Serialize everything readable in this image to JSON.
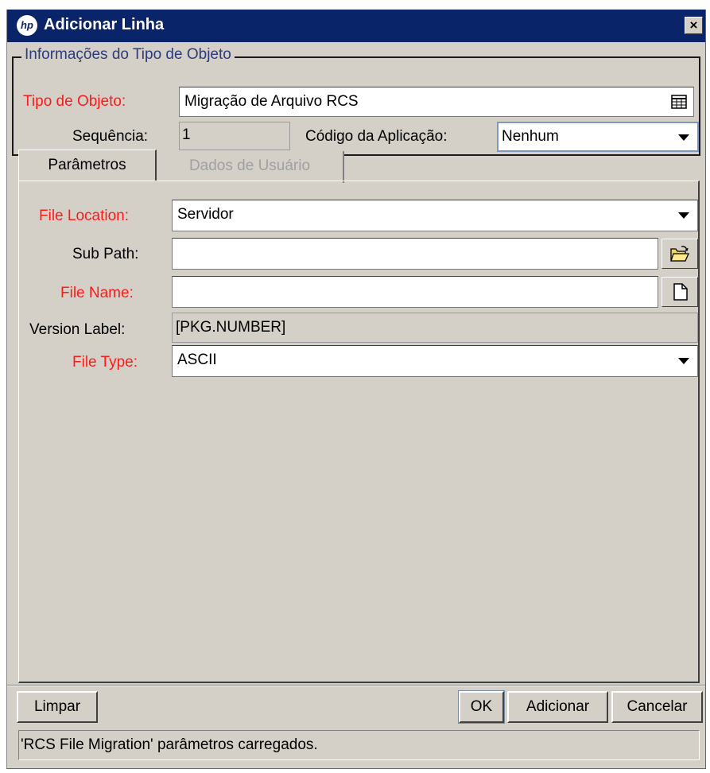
{
  "window": {
    "title": "Adicionar Linha",
    "logo_text": "hp",
    "close_label": "×"
  },
  "object_info": {
    "legend": "Informações do Tipo de Objeto",
    "object_type_label": "Tipo de Objeto:",
    "object_type_value": "Migração de Arquivo RCS",
    "sequence_label": "Sequência:",
    "sequence_value": "1",
    "app_code_label": "Código da Aplicação:",
    "app_code_value": "Nenhum"
  },
  "tabs": [
    {
      "label": "Parâmetros",
      "active": true
    },
    {
      "label": "Dados de Usuário",
      "active": false
    }
  ],
  "params": {
    "file_location_label": "File Location:",
    "file_location_value": "Servidor",
    "sub_path_label": "Sub Path:",
    "sub_path_value": "",
    "file_name_label": "File Name:",
    "file_name_value": "",
    "version_label_label": "Version Label:",
    "version_label_value": "[PKG.NUMBER]",
    "file_type_label": "File Type:",
    "file_type_value": "ASCII"
  },
  "buttons": {
    "clear": "Limpar",
    "ok": "OK",
    "add": "Adicionar",
    "cancel": "Cancelar"
  },
  "status_bar": "'RCS File Migration' parâmetros carregados.",
  "colors": {
    "required_label": "#ff1a1a",
    "titlebar": "#0a246a",
    "window_bg": "#d4d0c8",
    "legend_text": "#2e3b7a"
  },
  "icons": {
    "object_type_picker": "table-list-icon",
    "sub_path_browse": "folder-open-icon",
    "file_name_browse": "document-icon"
  }
}
